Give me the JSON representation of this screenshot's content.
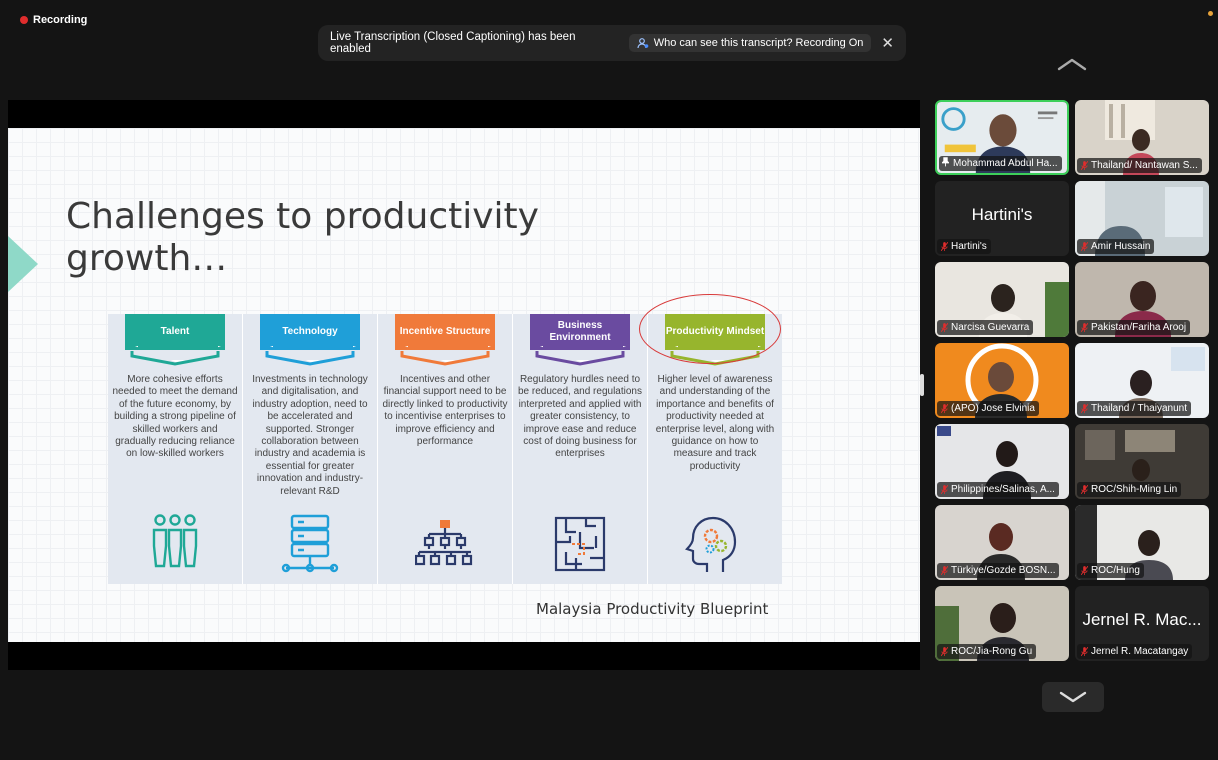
{
  "recording": {
    "label": "Recording",
    "color": "#e02d2d"
  },
  "banner": {
    "message": "Live Transcription (Closed Captioning) has been enabled",
    "who_label": "Who can see this transcript? Recording On",
    "close": "✕"
  },
  "slide": {
    "title": "Challenges to productivity growth…",
    "credit": "Malaysia Productivity Blueprint",
    "columns": [
      {
        "title": "Talent",
        "color": "#1fa896",
        "icon": "people-icon",
        "text": "More cohesive efforts needed to meet the demand of the future economy, by building a strong pipeline of skilled workers and gradually reducing reliance on low-skilled workers"
      },
      {
        "title": "Technology",
        "color": "#1f9fd8",
        "icon": "server-icon",
        "text": "Investments in technology and digitalisation, and industry adoption, need to be accelerated and supported. Stronger collaboration between industry and academia is essential for greater innovation and industry-relevant R&D"
      },
      {
        "title": "Incentive Structure",
        "color": "#f07a3a",
        "icon": "org-chart-icon",
        "text": "Incentives and other financial support need to be directly linked to productivity to incentivise enterprises to improve efficiency and performance"
      },
      {
        "title": "Business Environment",
        "color": "#6a4ba0",
        "icon": "maze-icon",
        "text": "Regulatory hurdles need to be reduced, and regulations interpreted and applied with greater consistency, to improve ease and reduce cost of doing business for enterprises"
      },
      {
        "title": "Productivity Mindset",
        "color": "#97b52d",
        "icon": "head-gears-icon",
        "text": "Higher level of awareness and understanding of the importance and benefits of productivity needed at enterprise level, along with guidance on how to measure and track productivity"
      }
    ]
  },
  "participants": [
    {
      "name": "Mohammad Abdul Ha...",
      "active": true
    },
    {
      "name": "Thailand/ Nantawan S..."
    },
    {
      "name": "Hartini's",
      "display": "Hartini's"
    },
    {
      "name": "Amir Hussain"
    },
    {
      "name": "Narcisa Guevarra"
    },
    {
      "name": "Pakistan/Fariha Arooj"
    },
    {
      "name": "(APO) Jose Elvinia"
    },
    {
      "name": "Thailand / Thaiyanunt"
    },
    {
      "name": "Philippines/Salinas, A..."
    },
    {
      "name": "ROC/Shih-Ming Lin"
    },
    {
      "name": "Türkiye/Gozde BOSN..."
    },
    {
      "name": "ROC/Hung"
    },
    {
      "name": "ROC/Jia-Rong Gu"
    },
    {
      "name": "Jernel R. Macatangay",
      "display": "Jernel R. Mac..."
    }
  ]
}
